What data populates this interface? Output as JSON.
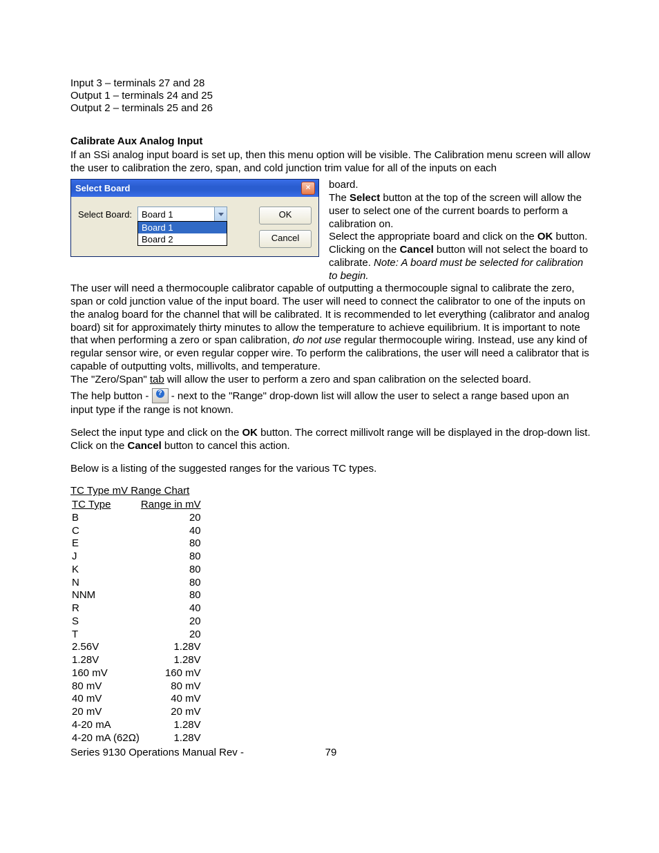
{
  "intro": {
    "l1": "Input 3 – terminals 27 and 28",
    "l2": "Output 1 – terminals 24 and 25",
    "l3": "Output 2 – terminals 25 and 26"
  },
  "section_heading": "Calibrate Aux Analog Input",
  "para1": "If an SSi analog input board is set up, then this menu option will be visible.  The Calibration menu screen will allow the user to calibration the zero, span, and cold junction trim value for all of the inputs on each ",
  "dialog": {
    "title": "Select Board",
    "label": "Select Board:",
    "value": "Board 1",
    "options": [
      "Board 1",
      "Board 2"
    ],
    "ok": "OK",
    "cancel": "Cancel"
  },
  "right": {
    "r1": "board.",
    "r2a": "The ",
    "select_b": "Select",
    "r2b": " button at the top of the screen will allow the user to select one of the current boards to perform a calibration on.",
    "r3a": "Select the appropriate board and click on the ",
    "ok_b": "OK",
    "r3b": " button.  Clicking on the ",
    "cancel_b": "Cancel",
    "r3c": " button will not select the board to calibrate.  ",
    "note": "Note: A board must be selected for calibration to begin."
  },
  "para_block": {
    "a1": "The user will need a thermocouple calibrator capable of outputting a thermocouple signal to calibrate the zero, span or cold junction value of the input board.  The user will need to connect the calibrator to one of the inputs on the analog board for the channel that will be calibrated.  It is recommended to let everything (calibrator and analog board) sit for approximately thirty minutes to allow the temperature to achieve equilibrium.  It is important to note that when performing a zero or span calibration, ",
    "dnu": "do not use",
    "a2": " regular thermocouple wiring.  Instead, use any kind of regular sensor wire, or even regular copper wire.  To perform the calibrations, the user will need a calibrator that is capable of outputting volts, millivolts, and temperature."
  },
  "zerospan": {
    "pre": "The \"Zero/Span\" ",
    "tab": "tab",
    "post": " will allow the user to perform a zero and span calibration on the selected board."
  },
  "help_line": {
    "pre": "The help button - ",
    "post": " - next to the \"Range\" drop-down list will allow the user to select a range based upon an input type if the range is not known."
  },
  "para_sel": {
    "a": "Select the input type and click on the ",
    "ok": "OK",
    "b": " button.  The correct millivolt range will be displayed in the drop-down list.  Click on the ",
    "cancel": "Cancel",
    "c": " button to cancel this action."
  },
  "below": "Below is a listing of the suggested ranges for the various TC types.",
  "chart": {
    "title": "TC Type mV Range Chart",
    "h1": "TC Type",
    "h2": "Range in mV",
    "rows": [
      [
        "B",
        "20"
      ],
      [
        "C",
        "40"
      ],
      [
        "E",
        "80"
      ],
      [
        "J",
        "80"
      ],
      [
        "K",
        "80"
      ],
      [
        "N",
        "80"
      ],
      [
        "NNM",
        "80"
      ],
      [
        "R",
        "40"
      ],
      [
        "S",
        "20"
      ],
      [
        "T",
        "20"
      ],
      [
        "2.56V",
        "1.28V"
      ],
      [
        "1.28V",
        "1.28V"
      ],
      [
        "160 mV",
        "160 mV"
      ],
      [
        "80 mV",
        "80 mV"
      ],
      [
        "40 mV",
        "40 mV"
      ],
      [
        "20 mV",
        "20 mV"
      ],
      [
        "4-20 mA",
        "1.28V"
      ],
      [
        "4-20 mA (62Ω)",
        "1.28V"
      ]
    ]
  },
  "footer": {
    "left": "Series 9130 Operations Manual Rev - ",
    "page": "79"
  }
}
